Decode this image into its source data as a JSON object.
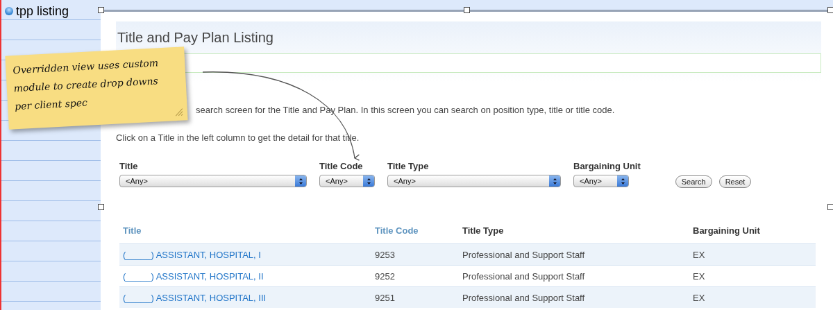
{
  "outline": {
    "title": "tpp listing"
  },
  "sticky_note": {
    "text": "Overridden view uses custom module to create drop downs per client spec"
  },
  "page": {
    "heading": "Title and Pay Plan Listing",
    "intro": "search screen for the Title and Pay Plan. In this screen you can search on position type, title or title code.",
    "instructions": "Click on a Title in the left column to get the detail for that title."
  },
  "filters": [
    {
      "label": "Title",
      "value": "<Any>"
    },
    {
      "label": "Title Code",
      "value": "<Any>"
    },
    {
      "label": "Title Type",
      "value": "<Any>"
    },
    {
      "label": "Bargaining Unit",
      "value": "<Any>"
    }
  ],
  "buttons": [
    "Search",
    "Reset"
  ],
  "table": {
    "columns": [
      {
        "label": "Title",
        "sortable": true
      },
      {
        "label": "Title Code",
        "sortable": true
      },
      {
        "label": "Title Type",
        "sortable": false
      },
      {
        "label": "Bargaining Unit",
        "sortable": false
      }
    ],
    "rows": [
      [
        "(_____) ASSISTANT, HOSPITAL, I",
        "9253",
        "Professional and Support Staff",
        "EX"
      ],
      [
        "(_____) ASSISTANT, HOSPITAL, II",
        "9252",
        "Professional and Support Staff",
        "EX"
      ],
      [
        "(_____) ASSISTANT, HOSPITAL, III",
        "9251",
        "Professional and Support Staff",
        "EX"
      ]
    ]
  }
}
